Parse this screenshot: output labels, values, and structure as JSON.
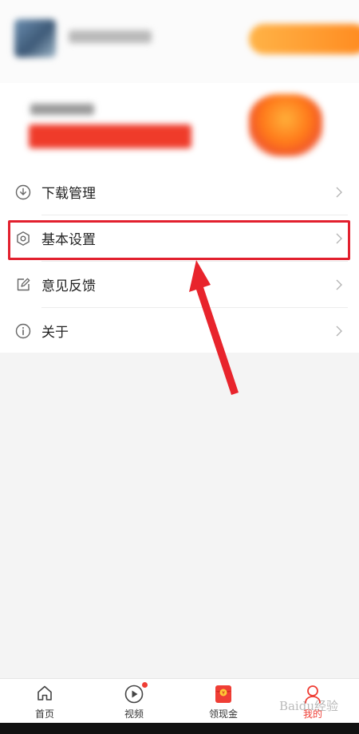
{
  "menu": {
    "items": [
      {
        "label": "下载管理",
        "icon": "download-circle-icon"
      },
      {
        "label": "基本设置",
        "icon": "hexagon-settings-icon"
      },
      {
        "label": "意见反馈",
        "icon": "edit-feedback-icon"
      },
      {
        "label": "关于",
        "icon": "info-circle-icon"
      }
    ],
    "highlighted_index": 1
  },
  "tabbar": {
    "tabs": [
      {
        "label": "首页",
        "icon": "home-icon"
      },
      {
        "label": "视频",
        "icon": "play-circle-icon",
        "badge": true
      },
      {
        "label": "领现金",
        "icon": "red-envelope-icon"
      },
      {
        "label": "我的",
        "icon": "user-icon",
        "active": true
      }
    ]
  },
  "watermark": "Baidu经验",
  "colors": {
    "accent": "#ef3e35",
    "annotation": "#e2202e",
    "banner_orange": "#ff8a1f"
  }
}
